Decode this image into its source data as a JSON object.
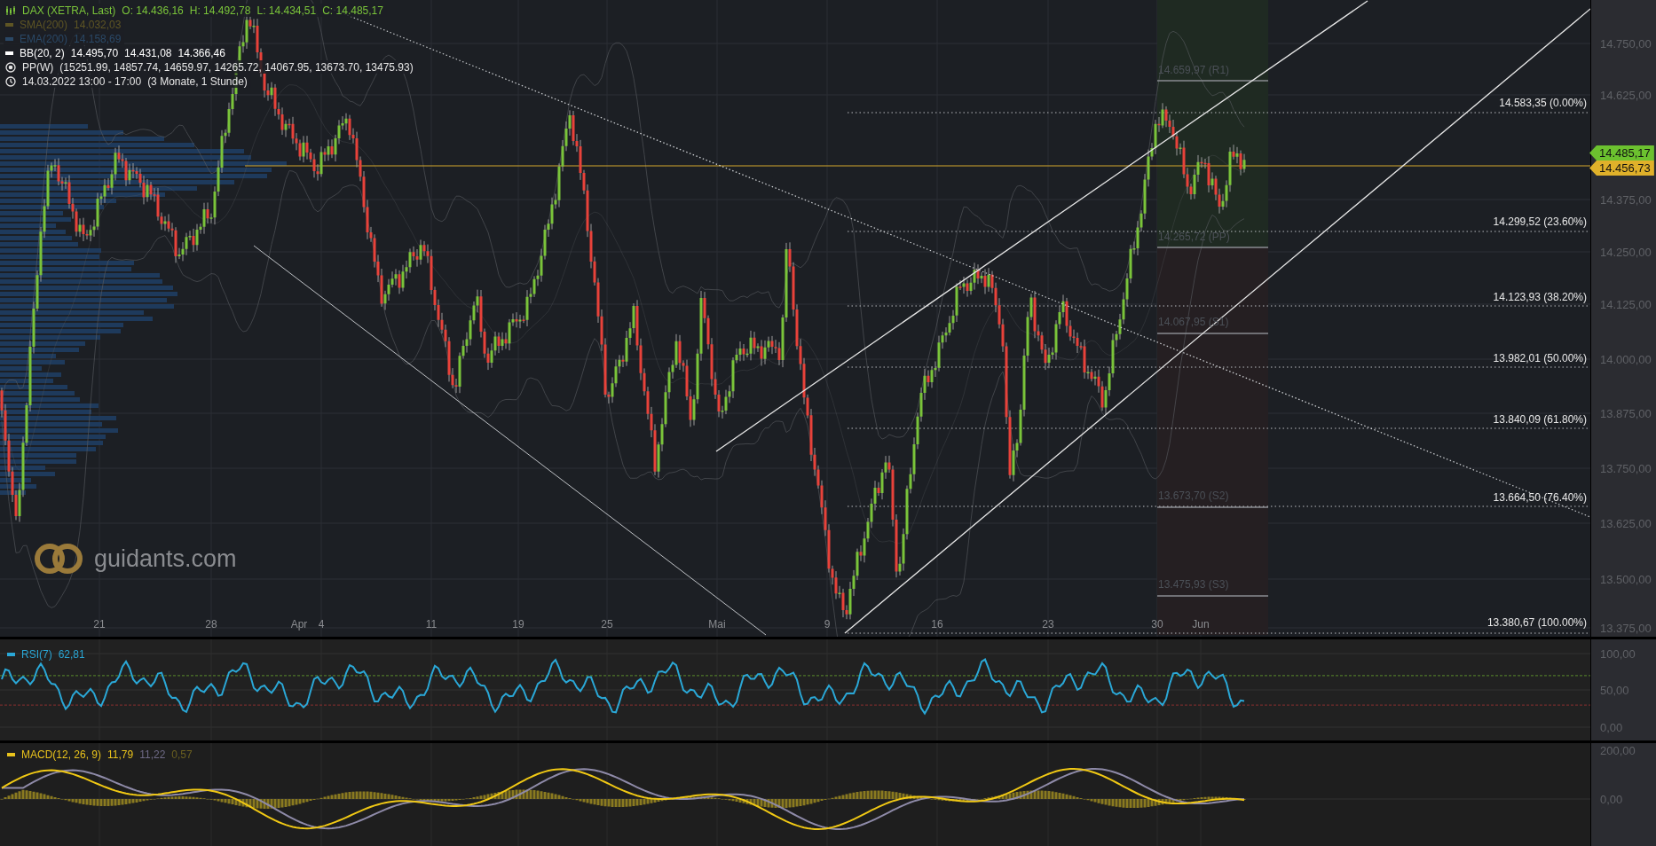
{
  "legend": [
    {
      "kind": "ohlc",
      "name": "DAX (XETRA, Last)",
      "values": [
        "O: 14.436,16",
        "H: 14.492,78",
        "L: 14.434,51",
        "C: 14.485,17"
      ]
    },
    {
      "kind": "line",
      "name": "SMA(200)",
      "values": [
        "14.032,03"
      ],
      "color": "#5e5524"
    },
    {
      "kind": "line",
      "name": "EMA(200)",
      "values": [
        "14.158,69"
      ],
      "color": "#2a4866"
    },
    {
      "kind": "line",
      "name": "BB(20, 2)",
      "values": [
        "14.495,70",
        "14.431,08",
        "14.366,46"
      ],
      "color": "#ffffff"
    },
    {
      "kind": "pivot",
      "name": "PP(W)",
      "values": [
        "(15251.99, 14857.74, 14659.97, 14265.72, 14067.95, 13673.70, 13475.93)"
      ]
    },
    {
      "kind": "time",
      "name": "14.03.2022 13:00 - 17:00",
      "values": [
        "(3 Monate, 1 Stunde)"
      ]
    }
  ],
  "logo": {
    "text": "guidants.com"
  },
  "price_axis": [
    "14.750,00",
    "14.625,00",
    "14.375,00",
    "14.250,00",
    "14.125,00",
    "14.000,00",
    "13.875,00",
    "13.750,00",
    "13.625,00",
    "13.500,00",
    "13.375,00"
  ],
  "price_tags": [
    {
      "kind": "last",
      "text": "14.485,17",
      "color": "#6cc12f"
    },
    {
      "kind": "line",
      "text": "14.456,73",
      "color": "#e0b12a"
    }
  ],
  "fibonacci_levels": [
    "14.583,35 (0.00%)",
    "14.299,52 (23.60%)",
    "14.123,93 (38.20%)",
    "13.982,01 (50.00%)",
    "13.840,09 (61.80%)",
    "13.664,50 (76.40%)",
    "13.380,67 (100.00%)"
  ],
  "pivot_levels": [
    "14.659,97 (R1)",
    "14.265,72 (PP)",
    "14.067,95 (S1)",
    "13.673,70 (S2)",
    "13.475,93 (S3)"
  ],
  "time_axis": [
    "21",
    "28",
    "Apr",
    "4",
    "11",
    "19",
    "25",
    "Mai",
    "9",
    "16",
    "23",
    "30",
    "Jun"
  ],
  "rsi": {
    "name": "RSI(7)",
    "value": "62,81",
    "axis": [
      "100,00",
      "50,00",
      "0,00"
    ]
  },
  "macd": {
    "name": "MACD(12, 26, 9)",
    "values": [
      "11,79",
      "11,22",
      "0,57"
    ],
    "axis": [
      "200,00",
      "0,00"
    ]
  }
}
